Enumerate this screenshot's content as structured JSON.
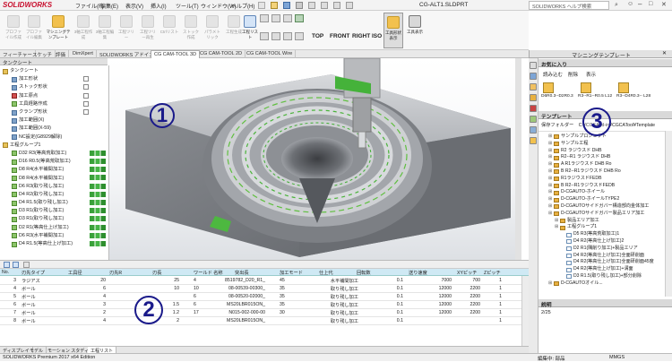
{
  "app": {
    "logo_text": "SOLIDWORKS",
    "title": "CG-ALT1.SLDPRT",
    "menu": [
      "ファイル(F)",
      "編集(E)",
      "表示(V)",
      "挿入(I)",
      "ツール(T)",
      "ウィンドウ(W)",
      "ヘルプ(H)"
    ],
    "help_search_placeholder": "SOLIDWORKS ヘルプ検索"
  },
  "toolbar": {
    "left_buttons": [
      "プロファイル作成",
      "プロファイル編集",
      "マシニングテンプレート",
      "3軸工程作成",
      "3軸工程編集",
      "工程ツリー",
      "工程ツリー再生",
      "Ctrlリスト",
      "ストック作成",
      "パラメトリック",
      "工程生成"
    ],
    "views": [
      "TOP",
      "FRONT",
      "RIGHT",
      "ISO"
    ],
    "right_buttons": [
      "工程リスト",
      "工具形状表示",
      "工具表示"
    ]
  },
  "tabs": [
    "フィーチャー",
    "スケッチ",
    "評価",
    "DimXpert",
    "SOLIDWORKS アドイン",
    "CG CAM-TOOL 3D",
    "CG CAM-TOOL 2D",
    "CG CAM-TOOL Wire"
  ],
  "active_tab": "CG CAM-TOOL 3D",
  "left_panel": {
    "header": "タンクシート",
    "tree": [
      {
        "label": "タンクシート",
        "icon": "folder",
        "indent": 0
      },
      {
        "label": "加工形状",
        "icon": "shape",
        "indent": 1
      },
      {
        "label": "ストック形状",
        "icon": "shape",
        "indent": 1
      },
      {
        "label": "加工原点",
        "icon": "origin",
        "indent": 1
      },
      {
        "label": "工具経路作成",
        "icon": "tool",
        "indent": 1
      },
      {
        "label": "クランプ形状",
        "icon": "clamp",
        "indent": 1
      },
      {
        "label": "加工範囲(X)",
        "icon": "range",
        "indent": 1
      },
      {
        "label": "加工範囲(X-59)",
        "icon": "range",
        "indent": 1
      },
      {
        "label": "NC設定(G8929解除)",
        "icon": "nc",
        "indent": 1
      },
      {
        "label": "工程グループ1",
        "icon": "group",
        "indent": 0
      },
      {
        "label": "D32 R3(等高荒取加工)",
        "icon": "op",
        "indent": 1
      },
      {
        "label": "D16 R0.5(等高荒取加工)",
        "icon": "op",
        "indent": 1
      },
      {
        "label": "D8 R4(水平補間加工)",
        "icon": "op",
        "indent": 1
      },
      {
        "label": "D8 R4(水平補間加工)",
        "icon": "op",
        "indent": 1
      },
      {
        "label": "D6 R3(取り残し加工)",
        "icon": "op",
        "indent": 1
      },
      {
        "label": "D4 R2(取り残し加工)",
        "icon": "op",
        "indent": 1
      },
      {
        "label": "D4 R1.5(取り残し加工)",
        "icon": "op",
        "indent": 1
      },
      {
        "label": "D3 R1(取り残し加工)",
        "icon": "op",
        "indent": 1
      },
      {
        "label": "D3 R1(取り残し加工)",
        "icon": "op",
        "indent": 1
      },
      {
        "label": "D2 R1(等高仕上げ加工)",
        "icon": "op",
        "indent": 1
      },
      {
        "label": "D6 R3(水平補間加工)",
        "icon": "op",
        "indent": 1
      },
      {
        "label": "D4 R1.5(等高仕上げ加工)",
        "icon": "op",
        "indent": 1
      }
    ]
  },
  "callouts": [
    "1",
    "2",
    "3"
  ],
  "grid": {
    "headers": [
      "No.",
      "刃先タイプ",
      "工具径",
      "刃先R",
      "刃長",
      "ワールド 名称",
      "突出長",
      "加工モード",
      "仕上代",
      "回転数",
      "送り速度",
      "XYピッチ",
      "Zピッチ"
    ],
    "rows": [
      [
        "3",
        "ラジアス",
        "20",
        "",
        "25",
        "4",
        "8519782_D20_R1_",
        "45",
        "水平補間加工",
        "0.1",
        "7000",
        "700",
        "1"
      ],
      [
        "4",
        "ボール",
        "6",
        "",
        "10",
        "10",
        "08-00539-00300_",
        "35",
        "取り残し加工",
        "0.1",
        "12000",
        "2200",
        "1"
      ],
      [
        "5",
        "ボール",
        "4",
        "",
        "",
        "6",
        "08-00520-02000_",
        "35",
        "取り残し加工",
        "0.1",
        "12000",
        "2200",
        "1"
      ],
      [
        "6",
        "ボール",
        "3",
        "",
        "1.5",
        "6",
        "MS20LBR015ON_",
        "35",
        "取り残し加工",
        "0.1",
        "12000",
        "2200",
        "1"
      ],
      [
        "7",
        "ボール",
        "2",
        "",
        "1.2",
        "17",
        "N015-002-000-00",
        "30",
        "取り残し加工",
        "0.1",
        "12000",
        "2200",
        "1"
      ],
      [
        "8",
        "ボール",
        "4",
        "",
        "2",
        "",
        "MS20LBR015ON_",
        "",
        "取り残し加工",
        "0.1",
        "",
        "",
        "1"
      ]
    ]
  },
  "bottom_tabs": [
    "ディスプレイ",
    "モデル",
    "モーション スタディ 1",
    "工程リスト"
  ],
  "active_bottom_tab": "工程リスト",
  "status": {
    "left": "SOLIDWORKS Premium 2017 x64 Edition",
    "right_label": "編集中: 部品",
    "units": "MMGS"
  },
  "right_panel": {
    "title": "マシニングテンプレート",
    "favorites_header": "お気に入り",
    "fav_toolbar": [
      "読み込む",
      "削除",
      "表示"
    ],
    "favorites": [
      {
        "label": "D6R0.3--D2R0.3"
      },
      {
        "label": "R3--R1--R0.5 L12"
      },
      {
        "label": "R3--D4R0.3-- L28"
      }
    ],
    "templates_header": "テンプレート",
    "folder_label": "保存フォルダー",
    "folder_path": "C:¥CGSAdd-in¥CGCATool¥Template",
    "tree": [
      {
        "label": "サンプルプロジェクト",
        "icon": "folder",
        "indent": 1
      },
      {
        "label": "サンプル工程",
        "icon": "folder",
        "indent": 1
      },
      {
        "label": "R2 ラジウスド DHB",
        "icon": "folder",
        "indent": 1
      },
      {
        "label": "R2--R1 ラジウスド DHB",
        "icon": "folder",
        "indent": 1
      },
      {
        "label": "A R1ラジウスド DHB Ro",
        "icon": "folder",
        "indent": 1
      },
      {
        "label": "B R2--R1ラジウスド DHB Ro",
        "icon": "folder",
        "indent": 1
      },
      {
        "label": "R1ラジウスドFEDB",
        "icon": "folder",
        "indent": 1
      },
      {
        "label": "B R2--R1ラジウスドFEDB",
        "icon": "folder",
        "indent": 1
      },
      {
        "label": "D-CGAUTO-ホイール",
        "icon": "folder",
        "indent": 1
      },
      {
        "label": "D-CGAUTO-ホイールTYPE2",
        "icon": "folder",
        "indent": 1
      },
      {
        "label": "D-CGAUTOサイドガバー構造部向金体加工",
        "icon": "folder",
        "indent": 1
      },
      {
        "label": "D-CGAUTOサイドガバー製品エリア加工",
        "icon": "folder",
        "indent": 1
      },
      {
        "label": "製品エリア加工",
        "icon": "folder",
        "indent": 2
      },
      {
        "label": "工程グループ1",
        "icon": "folder",
        "indent": 2
      },
      {
        "label": "D5 R3(等高荒取加工)1",
        "icon": "doc",
        "indent": 3
      },
      {
        "label": "D4 R2(等高仕上げ加工)2",
        "icon": "doc",
        "indent": 3
      },
      {
        "label": "D2 R1(隅削り加工)+製品エリア",
        "icon": "doc",
        "indent": 3
      },
      {
        "label": "D4 R2(等高仕上げ加工)全面研削面",
        "icon": "doc",
        "indent": 3
      },
      {
        "label": "D4 R2(等高仕上げ加工)全面研削面45度",
        "icon": "doc",
        "indent": 3
      },
      {
        "label": "D4 R2(等高仕上げ加工)+溝面",
        "icon": "doc",
        "indent": 3
      },
      {
        "label": "D3 R1.5(取り残し加工)+部分削除",
        "icon": "doc",
        "indent": 3
      },
      {
        "label": "D-CGAUTOオイル...",
        "icon": "folder",
        "indent": 1
      }
    ],
    "description_header": "説明",
    "page_info": "2/25"
  }
}
